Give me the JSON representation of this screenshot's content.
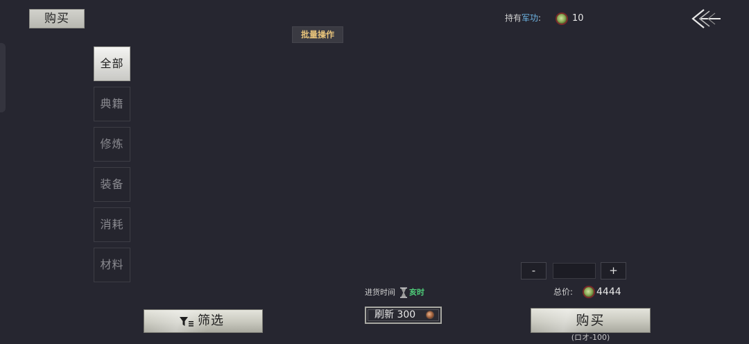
{
  "header": {
    "title": "购买",
    "batch_label": "批量操作"
  },
  "merit": {
    "label_prefix": "持有",
    "label_key": "军功",
    "label_suffix": ":",
    "value": "10"
  },
  "tabs": [
    {
      "label": "全部",
      "active": true
    },
    {
      "label": "典籍",
      "active": false
    },
    {
      "label": "修炼",
      "active": false
    },
    {
      "label": "装备",
      "active": false
    },
    {
      "label": "消耗",
      "active": false
    },
    {
      "label": "材料",
      "active": false
    }
  ],
  "quantity": {
    "minus": "-",
    "plus": "+",
    "value": ""
  },
  "total": {
    "label": "总价:",
    "value": "4444"
  },
  "restock": {
    "label": "进货时间",
    "value": "亥时"
  },
  "refresh": {
    "label": "刷新 300"
  },
  "filter": {
    "label": "筛选"
  },
  "buy": {
    "label": "购买",
    "note": "(ロオ-100)"
  },
  "colors": {
    "background": "#262630",
    "accent_gold": "#e6c27a",
    "merit_key": "#6fb8e8",
    "restock_green": "#4fcf7a"
  },
  "icons": [
    "back-arrow-icon",
    "merit-coin-icon",
    "hourglass-icon",
    "copper-coin-icon",
    "filter-icon"
  ]
}
